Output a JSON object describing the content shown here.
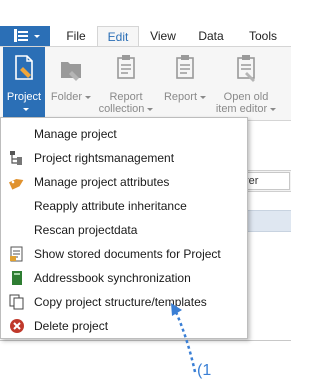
{
  "tabs": {
    "file": "File",
    "edit": "Edit",
    "view": "View",
    "data": "Data",
    "tools": "Tools"
  },
  "ribbon": {
    "project": "Project",
    "folder": "Folder",
    "report_collection_1": "Report",
    "report_collection_2": "collection",
    "report": "Report",
    "open_old_1": "Open old",
    "open_old_2": "item editor"
  },
  "background": {
    "field_text": "rer"
  },
  "menu": {
    "items": [
      {
        "label": "Manage project",
        "icon": "none"
      },
      {
        "label": "Project rightsmanagement",
        "icon": "rights-tree-icon"
      },
      {
        "label": "Manage project attributes",
        "icon": "tag-icon"
      },
      {
        "label": "Reapply attribute inheritance",
        "icon": "none"
      },
      {
        "label": "Rescan projectdata",
        "icon": "none"
      },
      {
        "label": "Show stored documents for Project",
        "icon": "stored-documents-icon"
      },
      {
        "label": "Addressbook synchronization",
        "icon": "addressbook-icon"
      },
      {
        "label": "Copy project structure/templates",
        "icon": "copy-icon"
      },
      {
        "label": "Delete project",
        "icon": "delete-icon"
      }
    ]
  },
  "annotation": {
    "label": "(1"
  },
  "colors": {
    "accent": "#2b6fb6",
    "annotation": "#3a7fd5",
    "delete_red": "#c0392b",
    "addressbook_green": "#2e7d32",
    "tag_orange": "#e0922f"
  }
}
